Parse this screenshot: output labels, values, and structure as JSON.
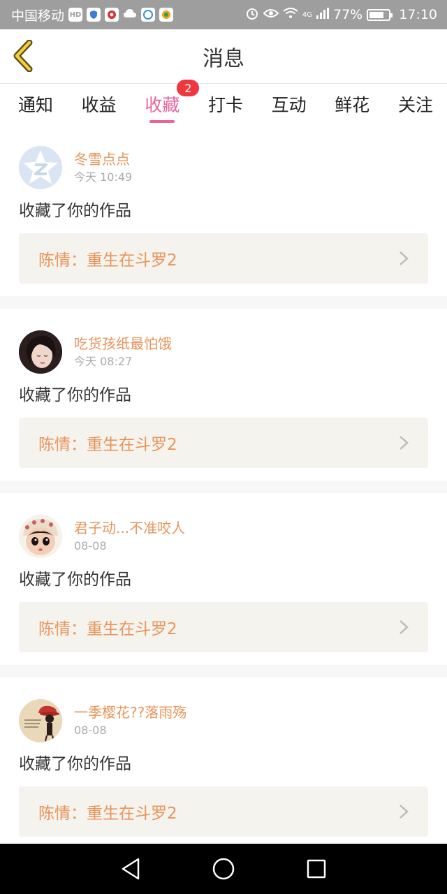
{
  "status_bar": {
    "carrier": "中国移动",
    "hd_badge": "HD",
    "network": "4G",
    "battery": "77%",
    "battery_fraction": 0.77,
    "time": "17:10",
    "icons": [
      "hd-icon",
      "shield-app-icon",
      "weibo-app-icon",
      "cloud-icon",
      "browser-app-icon",
      "photo-app-icon",
      "alarm-icon",
      "eye-icon",
      "wifi-icon",
      "signal-icon"
    ]
  },
  "header": {
    "title": "消息",
    "back_icon": "chevron-left-icon"
  },
  "tabs": [
    {
      "label": "通知",
      "active": false
    },
    {
      "label": "收益",
      "active": false
    },
    {
      "label": "收藏",
      "active": true,
      "badge": "2"
    },
    {
      "label": "打卡",
      "active": false
    },
    {
      "label": "互动",
      "active": false
    },
    {
      "label": "鲜花",
      "active": false
    },
    {
      "label": "关注",
      "active": false
    }
  ],
  "messages": [
    {
      "username": "冬雪点点",
      "time": "今天 10:49",
      "action": "收藏了你的作品",
      "work_title": "陈情：重生在斗罗2",
      "avatar": "qzone-default-avatar"
    },
    {
      "username": "吃货孩纸最怕饿",
      "time": "今天 08:27",
      "action": "收藏了你的作品",
      "work_title": "陈情：重生在斗罗2",
      "avatar": "girl-photo-avatar"
    },
    {
      "username": "君子动...不准咬人",
      "time": "08-08",
      "action": "收藏了你的作品",
      "work_title": "陈情：重生在斗罗2",
      "avatar": "doll-avatar"
    },
    {
      "username": "一季樱花??落雨殇",
      "time": "08-08",
      "action": "收藏了你的作品",
      "work_title": "陈情：重生在斗罗2",
      "avatar": "red-hat-avatar"
    }
  ],
  "colors": {
    "accent_pink": "#e8659c",
    "username_orange": "#e8945a",
    "badge_red": "#f0363f",
    "work_box_bg": "#f5f3ee",
    "status_bar_bg": "#9e9e9e"
  },
  "nav_bar": {
    "buttons": [
      "back-triangle-icon",
      "home-circle-icon",
      "recents-square-icon"
    ]
  }
}
